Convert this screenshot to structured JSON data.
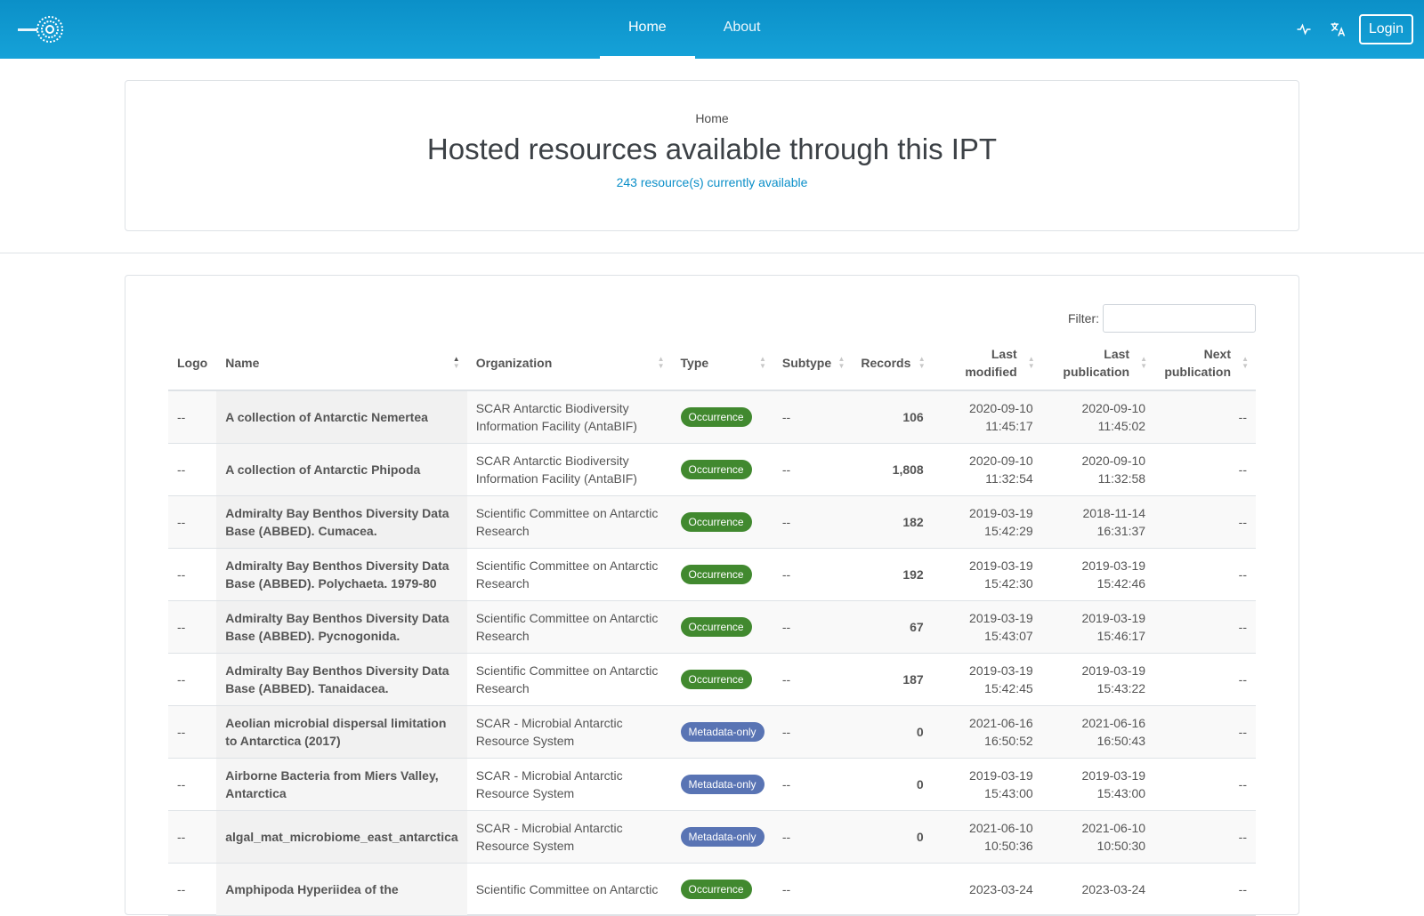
{
  "nav": {
    "home_label": "Home",
    "about_label": "About",
    "login_label": "Login",
    "icons": [
      "activity-icon",
      "translate-icon"
    ],
    "brand_color": "#0b90c8"
  },
  "header": {
    "breadcrumb": "Home",
    "title": "Hosted resources available through this IPT",
    "count_text": "243 resource(s) currently available"
  },
  "table": {
    "filter_label": "Filter:",
    "filter_value": "",
    "columns": {
      "logo": "Logo",
      "name": "Name",
      "organization": "Organization",
      "type": "Type",
      "subtype": "Subtype",
      "records": "Records",
      "last_modified_1": "Last",
      "last_modified_2": "modified",
      "last_publication_1": "Last",
      "last_publication_2": "publication",
      "next_publication_1": "Next",
      "next_publication_2": "publication"
    },
    "rows": [
      {
        "logo": "--",
        "name": "A collection of Antarctic Nemertea",
        "org": "SCAR Antarctic Biodiversity Information Facility (AntaBIF)",
        "type": "Occurrence",
        "subtype": "--",
        "records": "106",
        "mod_date": "2020-09-10",
        "mod_time": "11:45:17",
        "pub_date": "2020-09-10",
        "pub_time": "11:45:02",
        "next": "--"
      },
      {
        "logo": "--",
        "name": "A collection of Antarctic Phipoda",
        "org": "SCAR Antarctic Biodiversity Information Facility (AntaBIF)",
        "type": "Occurrence",
        "subtype": "--",
        "records": "1,808",
        "mod_date": "2020-09-10",
        "mod_time": "11:32:54",
        "pub_date": "2020-09-10",
        "pub_time": "11:32:58",
        "next": "--"
      },
      {
        "logo": "--",
        "name": "Admiralty Bay Benthos Diversity Data Base (ABBED). Cumacea.",
        "org": "Scientific Committee on Antarctic Research",
        "type": "Occurrence",
        "subtype": "--",
        "records": "182",
        "mod_date": "2019-03-19",
        "mod_time": "15:42:29",
        "pub_date": "2018-11-14",
        "pub_time": "16:31:37",
        "next": "--"
      },
      {
        "logo": "--",
        "name": "Admiralty Bay Benthos Diversity Data Base (ABBED). Polychaeta. 1979-80",
        "org": "Scientific Committee on Antarctic Research",
        "type": "Occurrence",
        "subtype": "--",
        "records": "192",
        "mod_date": "2019-03-19",
        "mod_time": "15:42:30",
        "pub_date": "2019-03-19",
        "pub_time": "15:42:46",
        "next": "--"
      },
      {
        "logo": "--",
        "name": "Admiralty Bay Benthos Diversity Data Base (ABBED). Pycnogonida.",
        "org": "Scientific Committee on Antarctic Research",
        "type": "Occurrence",
        "subtype": "--",
        "records": "67",
        "mod_date": "2019-03-19",
        "mod_time": "15:43:07",
        "pub_date": "2019-03-19",
        "pub_time": "15:46:17",
        "next": "--"
      },
      {
        "logo": "--",
        "name": "Admiralty Bay Benthos Diversity Data Base (ABBED). Tanaidacea.",
        "org": "Scientific Committee on Antarctic Research",
        "type": "Occurrence",
        "subtype": "--",
        "records": "187",
        "mod_date": "2019-03-19",
        "mod_time": "15:42:45",
        "pub_date": "2019-03-19",
        "pub_time": "15:43:22",
        "next": "--"
      },
      {
        "logo": "--",
        "name": "Aeolian microbial dispersal limitation to Antarctica (2017)",
        "org": "SCAR - Microbial Antarctic Resource System",
        "type": "Metadata-only",
        "subtype": "--",
        "records": "0",
        "mod_date": "2021-06-16",
        "mod_time": "16:50:52",
        "pub_date": "2021-06-16",
        "pub_time": "16:50:43",
        "next": "--"
      },
      {
        "logo": "--",
        "name": "Airborne Bacteria from Miers Valley, Antarctica",
        "org": "SCAR - Microbial Antarctic Resource System",
        "type": "Metadata-only",
        "subtype": "--",
        "records": "0",
        "mod_date": "2019-03-19",
        "mod_time": "15:43:00",
        "pub_date": "2019-03-19",
        "pub_time": "15:43:00",
        "next": "--"
      },
      {
        "logo": "--",
        "name": "algal_mat_microbiome_east_antarctica",
        "org": "SCAR - Microbial Antarctic Resource System",
        "type": "Metadata-only",
        "subtype": "--",
        "records": "0",
        "mod_date": "2021-06-10",
        "mod_time": "10:50:36",
        "pub_date": "2021-06-10",
        "pub_time": "10:50:30",
        "next": "--"
      },
      {
        "logo": "--",
        "name": "Amphipoda Hyperiidea of the",
        "org": "Scientific Committee on Antarctic",
        "type": "Occurrence",
        "subtype": "--",
        "records": "",
        "mod_date": "2023-03-24",
        "mod_time": "",
        "pub_date": "2023-03-24",
        "pub_time": "",
        "next": "--"
      }
    ]
  }
}
